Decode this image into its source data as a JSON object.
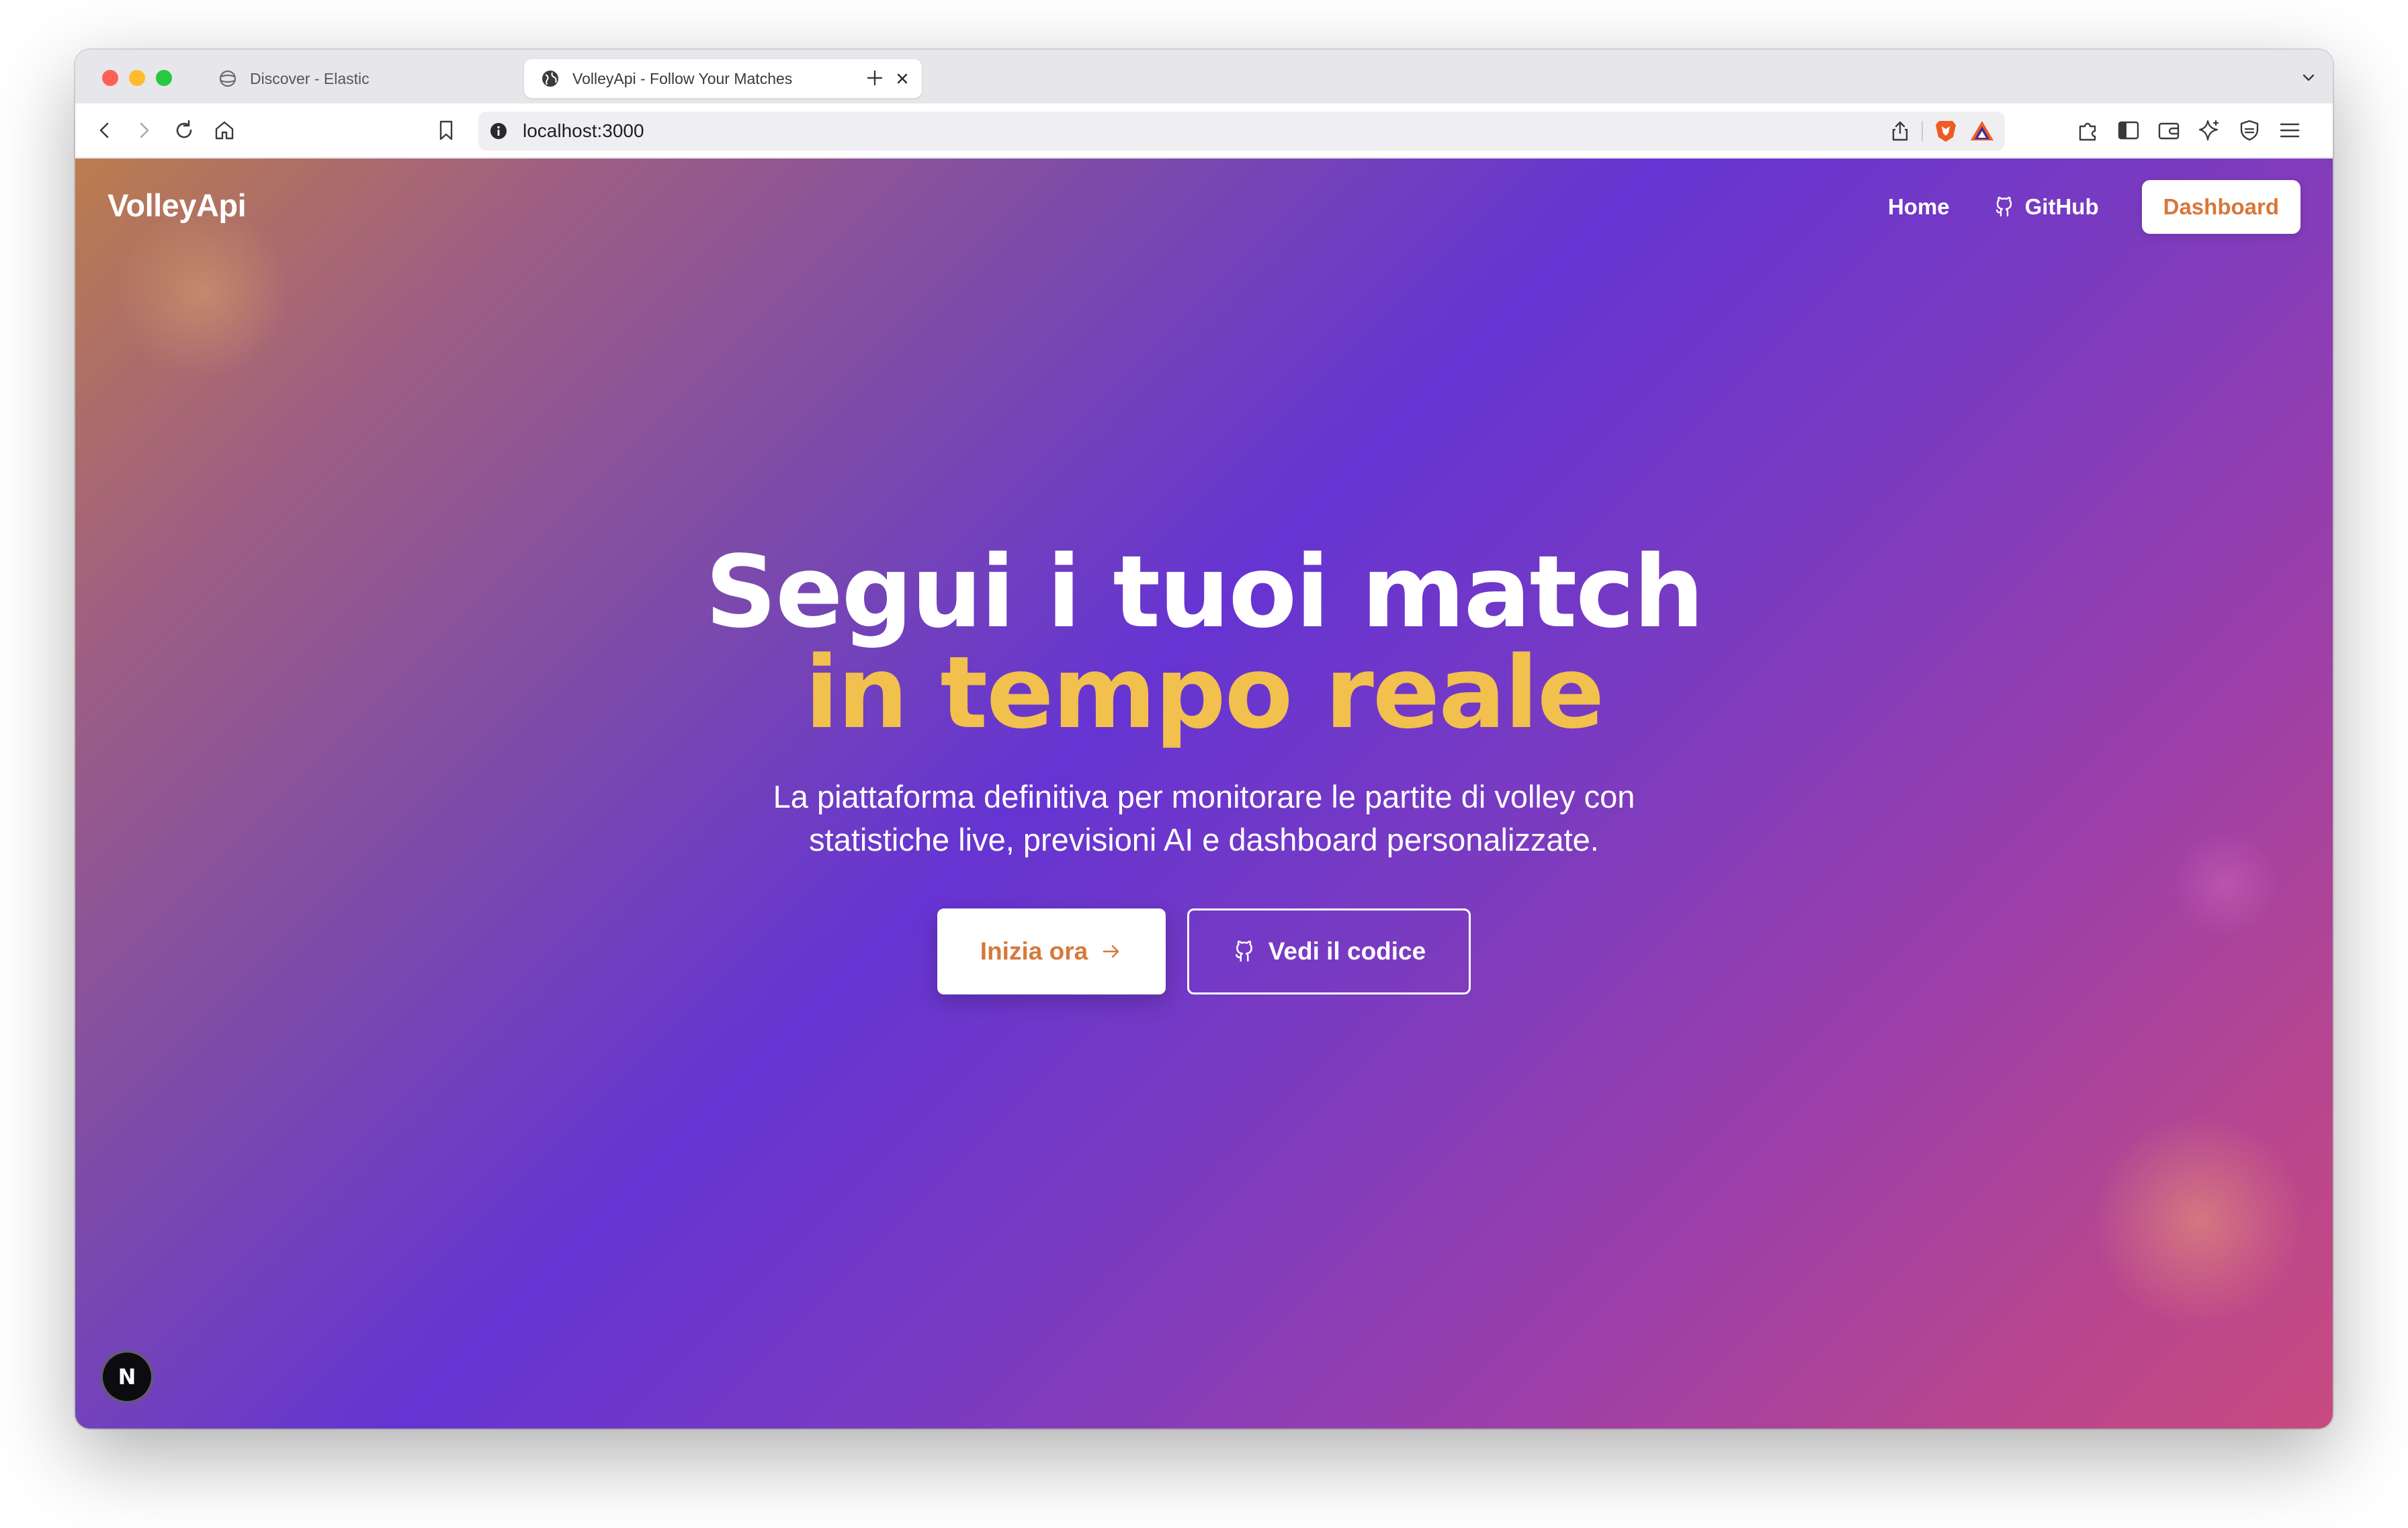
{
  "browser": {
    "tabs": [
      {
        "title": "Discover - Elastic",
        "icon": "elastic-icon",
        "active": false
      },
      {
        "title": "VolleyApi - Follow Your Matches",
        "icon": "globe-icon",
        "active": true
      }
    ],
    "url": "localhost:3000"
  },
  "site": {
    "brand": "VolleyApi",
    "nav": {
      "home": "Home",
      "github": "GitHub",
      "dashboard": "Dashboard"
    },
    "hero": {
      "title_line1": "Segui i tuoi match",
      "title_line2": "in tempo reale",
      "subtitle": "La piattaforma definitiva per monitorare le partite di volley con statistiche live, previsioni AI e dashboard personalizzate.",
      "primary_cta": "Inizia ora",
      "secondary_cta": "Vedi il codice"
    },
    "dev_badge": "N"
  },
  "colors": {
    "accent_orange": "#d6783b",
    "highlight_yellow": "#f2c04c",
    "gradient_purple": "#6634d2",
    "gradient_pink": "#c84a80"
  }
}
